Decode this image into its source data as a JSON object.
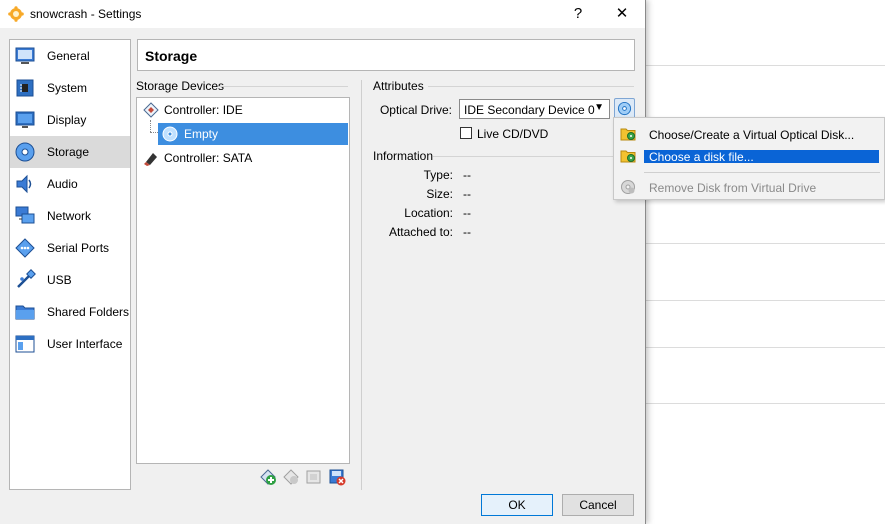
{
  "window": {
    "title": "snowcrash - Settings",
    "help_glyph": "?",
    "close_glyph": "✕"
  },
  "sidebar": {
    "items": [
      {
        "label": "General",
        "icon": "general-icon"
      },
      {
        "label": "System",
        "icon": "system-icon"
      },
      {
        "label": "Display",
        "icon": "display-icon"
      },
      {
        "label": "Storage",
        "icon": "storage-icon",
        "selected": true
      },
      {
        "label": "Audio",
        "icon": "audio-icon"
      },
      {
        "label": "Network",
        "icon": "network-icon"
      },
      {
        "label": "Serial Ports",
        "icon": "serial-ports-icon"
      },
      {
        "label": "USB",
        "icon": "usb-icon"
      },
      {
        "label": "Shared Folders",
        "icon": "shared-folders-icon"
      },
      {
        "label": "User Interface",
        "icon": "user-interface-icon"
      }
    ]
  },
  "page": {
    "title": "Storage"
  },
  "storage_devices": {
    "group_title": "Storage Devices",
    "tree": [
      {
        "label": "Controller: IDE",
        "icon": "ide-controller-icon"
      },
      {
        "label": "Empty",
        "icon": "optical-disc-icon",
        "selected": true
      },
      {
        "label": "Controller: SATA",
        "icon": "sata-controller-icon"
      }
    ]
  },
  "attributes": {
    "group_title": "Attributes",
    "optical_drive_label": "Optical Drive:",
    "optical_drive_value": "IDE Secondary Device 0",
    "live_cd_label": "Live CD/DVD",
    "live_cd_checked": false
  },
  "information": {
    "group_title": "Information",
    "rows": [
      {
        "label": "Type:",
        "value": "--"
      },
      {
        "label": "Size:",
        "value": "--"
      },
      {
        "label": "Location:",
        "value": "--"
      },
      {
        "label": "Attached to:",
        "value": "--"
      }
    ]
  },
  "buttons": {
    "ok": "OK",
    "cancel": "Cancel"
  },
  "disk_menu": {
    "items": [
      {
        "label": "Choose/Create a Virtual Optical Disk...",
        "icon": "optical-disk-folder-icon"
      },
      {
        "label": "Choose a disk file...",
        "icon": "disk-file-folder-icon",
        "highlighted": true
      },
      {
        "label": "Remove Disk from Virtual Drive",
        "icon": "remove-disk-icon",
        "disabled": true
      }
    ]
  },
  "colors": {
    "selection": "#3d8ee0",
    "menu_highlight": "#0a64d6",
    "sidebar_selected": "#dadada"
  }
}
